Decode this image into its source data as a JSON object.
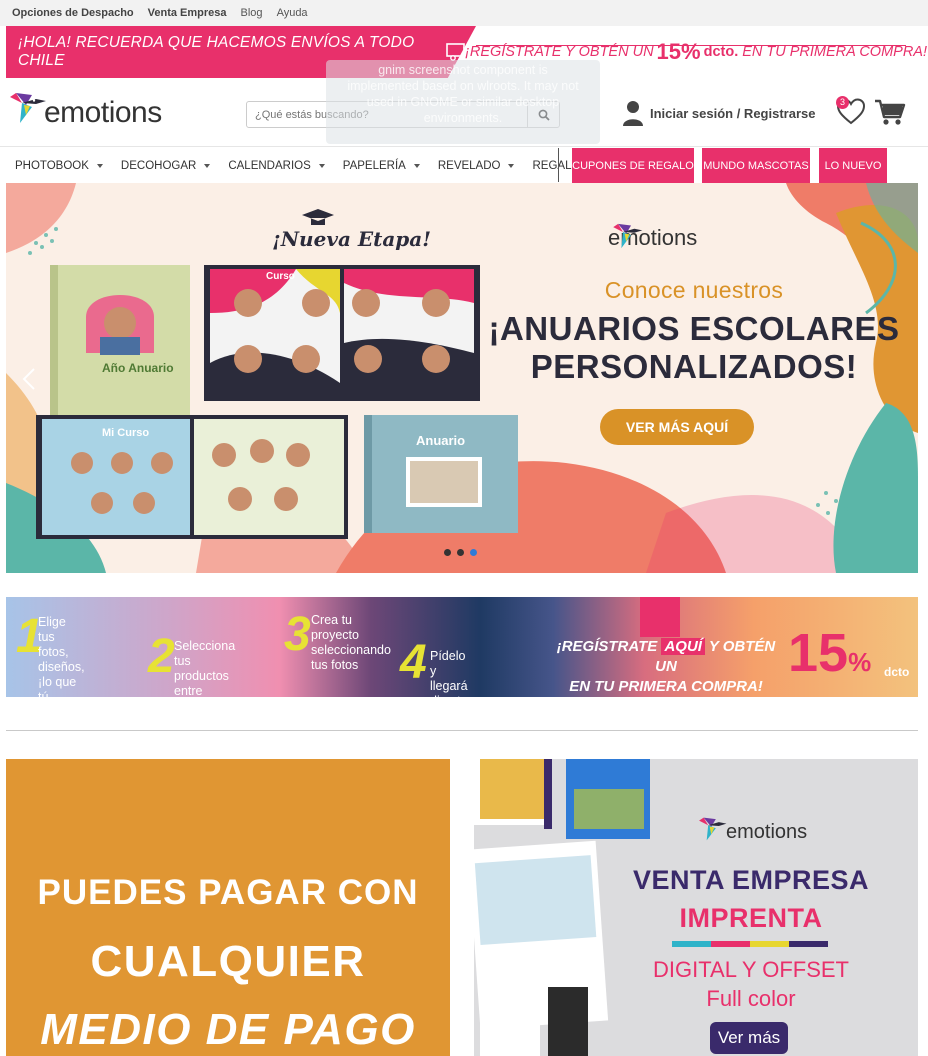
{
  "topbar": {
    "links": [
      "Opciones de Despacho",
      "Venta Empresa",
      "Blog",
      "Ayuda"
    ]
  },
  "promo": {
    "left_text": "¡HOLA! RECUERDA QUE HACEMOS ENVÍOS A TODO CHILE",
    "right_prefix": "¡REGÍSTRATE Y OBTÉN UN",
    "right_pct": "15%",
    "right_dcto": "dcto.",
    "right_suffix": "EN TU PRIMERA COMPRA!"
  },
  "header": {
    "logo_text": "emotions",
    "search_placeholder": "¿Qué estás buscando?",
    "account_text": "Iniciar sesión / Registrarse",
    "wishlist_count": "3",
    "ghost_overlay": "gnim screenshot component is\nimplemented based on wlroots. It may not\nused in GNOME or similar desktop\nenvironments."
  },
  "nav": {
    "items": [
      "PHOTOBOOK",
      "DECOHOGAR",
      "CALENDARIOS",
      "PAPELERÍA",
      "REVELADO",
      "REGALOS"
    ],
    "pills": [
      "CUPONES DE REGALO",
      "MUNDO MASCOTAS",
      "LO NUEVO"
    ]
  },
  "hero": {
    "etapa": "¡Nueva Etapa!",
    "logo_text": "emotions",
    "subtitle": "Conoce nuestros",
    "title_1": "¡ANUARIOS ESCOLARES",
    "title_2": "PERSONALIZADOS!",
    "button": "VER MÁS AQUÍ",
    "book_labels": [
      "Año Anuario",
      "Mi Curso",
      "Curso",
      "Anuario"
    ]
  },
  "steps": {
    "s1_num": "1",
    "s1_text": "Elige tus fotos,\ndiseños, ¡lo que\ntú quieras!",
    "s2_num": "2",
    "s2_text": "Selecciona tus\nproductos entre\ncientos de opciones",
    "s3_num": "3",
    "s3_text": "Crea tu proyecto\nseleccionando\ntus fotos",
    "s4_num": "4",
    "s4_text": "Pídelo y llegará\ndirecto a tu casa",
    "promo_a": "¡REGÍSTRATE",
    "promo_aqui": "AQUÍ",
    "promo_b": "Y OBTÉN UN",
    "promo_c": "EN TU PRIMERA COMPRA!",
    "pct": "15",
    "pct_sign": "%",
    "dcto": "dcto"
  },
  "card_left": {
    "line1": "PUEDES PAGAR CON",
    "line2": "CUALQUIER",
    "line3": "MEDIO DE PAGO"
  },
  "card_right": {
    "logo_text": "emotions",
    "t1": "VENTA EMPRESA",
    "t2": "IMPRENTA",
    "t3": "DIGITAL Y OFFSET",
    "t4": "Full color",
    "button": "Ver más",
    "stripe_colors": [
      "#2fb3c9",
      "#e8306b",
      "#e7d630",
      "#3a2a6b"
    ]
  },
  "colors": {
    "brand_pink": "#e8306b",
    "gold": "#d99227",
    "navy": "#2b2b3b"
  }
}
